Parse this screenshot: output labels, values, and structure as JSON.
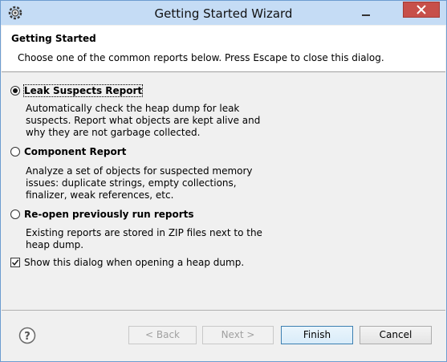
{
  "window": {
    "title": "Getting Started Wizard"
  },
  "header": {
    "title": "Getting Started",
    "description": "Choose one of the common reports below. Press Escape to close this dialog."
  },
  "options": [
    {
      "label": "Leak Suspects Report",
      "selected": true,
      "description": "Automatically check the heap dump for leak suspects. Report what objects are kept alive and why they are not garbage collected."
    },
    {
      "label": "Component Report",
      "selected": false,
      "description": "Analyze a set of objects for suspected memory issues: duplicate strings, empty collections, finalizer, weak references, etc."
    },
    {
      "label": "Re-open previously run reports",
      "selected": false,
      "description": "Existing reports are stored in ZIP files next to the heap dump."
    }
  ],
  "show_dialog": {
    "label": "Show this dialog when opening a heap dump.",
    "checked": true
  },
  "buttons": {
    "back": "< Back",
    "next": "Next >",
    "finish": "Finish",
    "cancel": "Cancel"
  },
  "icons": {
    "app": "eclipse-gear-icon",
    "minimize": "minimize-icon",
    "close": "close-icon",
    "help": "help-icon"
  },
  "colors": {
    "titlebar": "#c5dcf5",
    "close_button": "#c7504a",
    "header_background": "#ffffff",
    "dialog_background": "#f0f0f0",
    "default_button_border": "#3c7fb1"
  }
}
